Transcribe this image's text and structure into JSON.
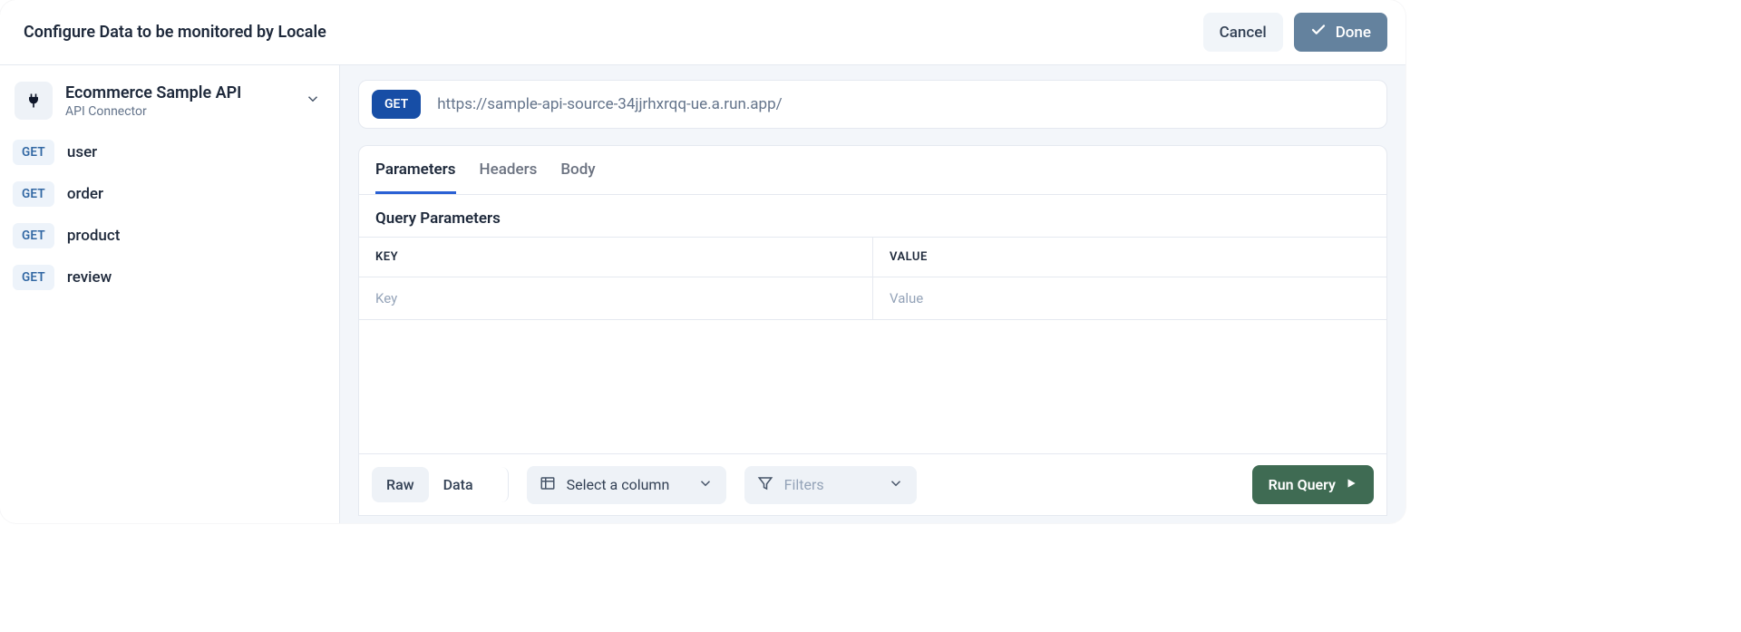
{
  "header": {
    "title": "Configure Data to be monitored by Locale",
    "cancel": "Cancel",
    "done": "Done"
  },
  "sidebar": {
    "connector_name": "Ecommerce Sample API",
    "connector_sub": "API Connector",
    "endpoints": [
      {
        "method": "GET",
        "label": "user"
      },
      {
        "method": "GET",
        "label": "order"
      },
      {
        "method": "GET",
        "label": "product"
      },
      {
        "method": "GET",
        "label": "review"
      }
    ]
  },
  "request": {
    "method": "GET",
    "url": "https://sample-api-source-34jjrhxrqq-ue.a.run.app/"
  },
  "tabs": {
    "parameters": "Parameters",
    "headers": "Headers",
    "body": "Body",
    "active": "parameters"
  },
  "params": {
    "section_title": "Query Parameters",
    "key_header": "KEY",
    "value_header": "VALUE",
    "key_placeholder": "Key",
    "value_placeholder": "Value"
  },
  "toolbar": {
    "raw": "Raw",
    "data": "Data",
    "select_column": "Select a column",
    "filters": "Filters",
    "run": "Run Query"
  }
}
